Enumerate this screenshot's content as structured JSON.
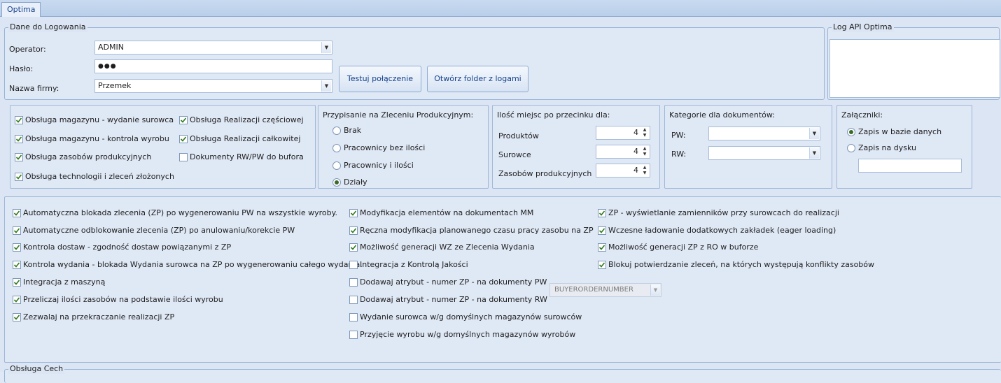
{
  "tabs": [
    {
      "label": "Optima"
    }
  ],
  "login": {
    "title": "Dane do Logowania",
    "operator_label": "Operator:",
    "operator_value": "ADMIN",
    "password_label": "Hasło:",
    "password_value": "●●●",
    "company_label": "Nazwa firmy:",
    "company_value": "Przemek",
    "test_button": "Testuj połączenie",
    "open_logs_button": "Otwórz folder z logami"
  },
  "log": {
    "title": "Log API Optima"
  },
  "options": [
    {
      "label": "Obsługa magazynu - wydanie surowca",
      "checked": true
    },
    {
      "label": "Obsługa magazynu - kontrola wyrobu",
      "checked": true
    },
    {
      "label": "Obsługa zasobów produkcyjnych",
      "checked": true
    },
    {
      "label": "Obsługa technologii i zleceń złożonych",
      "checked": true
    },
    {
      "label": "Obsługa Realizacji częściowej",
      "checked": true
    },
    {
      "label": "Obsługa Realizacji całkowitej",
      "checked": true
    },
    {
      "label": "Dokumenty RW/PW do bufora",
      "checked": false
    }
  ],
  "assignment": {
    "title": "Przypisanie na Zleceniu Produkcyjnym:",
    "options": [
      "Brak",
      "Pracownicy bez ilości",
      "Pracownicy i ilości",
      "Działy"
    ],
    "selected": "Działy"
  },
  "decimals": {
    "title": "Ilość miejsc po przecinku dla:",
    "rows": [
      {
        "label": "Produktów",
        "value": "4"
      },
      {
        "label": "Surowce",
        "value": "4"
      },
      {
        "label": "Zasobów produkcyjnych",
        "value": "4"
      }
    ]
  },
  "categories": {
    "title": "Kategorie dla dokumentów:",
    "pw_label": "PW:",
    "pw_value": "",
    "rw_label": "RW:",
    "rw_value": ""
  },
  "attachments": {
    "title": "Załączniki:",
    "options": [
      "Zapis w bazie danych",
      "Zapis na dysku"
    ],
    "selected": "Zapis w bazie danych",
    "path_value": ""
  },
  "settings_col1": [
    {
      "label": "Automatyczna blokada zlecenia (ZP) po wygenerowaniu PW na wszystkie wyroby.",
      "checked": true
    },
    {
      "label": "Automatyczne odblokowanie zlecenia (ZP) po anulowaniu/korekcie PW",
      "checked": true
    },
    {
      "label": "Kontrola dostaw - zgodność dostaw powiązanymi z ZP",
      "checked": true
    },
    {
      "label": "Kontrola wydania - blokada Wydania surowca na ZP po wygenerowaniu całego wydania.",
      "checked": true
    },
    {
      "label": "Integracja z maszyną",
      "checked": true
    },
    {
      "label": "Przeliczaj ilości zasobów na podstawie ilości wyrobu",
      "checked": true
    },
    {
      "label": "Zezwalaj na przekraczanie realizacji ZP",
      "checked": true
    }
  ],
  "settings_col2": [
    {
      "label": "Modyfikacja elementów na dokumentach MM",
      "checked": true
    },
    {
      "label": "Ręczna modyfikacja planowanego czasu pracy zasobu  na ZP",
      "checked": true
    },
    {
      "label": "Możliwość generacji WZ ze Zlecenia Wydania",
      "checked": true
    },
    {
      "label": "Integracja z Kontrolą Jakości",
      "checked": false
    },
    {
      "label": "Dodawaj atrybut - numer ZP - na dokumenty PW",
      "checked": false
    },
    {
      "label": "Dodawaj atrybut - numer ZP - na dokumenty RW",
      "checked": false
    },
    {
      "label": "Wydanie surowca w/g domyślnych magazynów surowców",
      "checked": false
    },
    {
      "label": "Przyjęcie wyrobu w/g domyślnych magazynów wyrobów",
      "checked": false
    }
  ],
  "attribute_combo": {
    "value": "BUYERORDERNUMBER"
  },
  "settings_col3": [
    {
      "label": "ZP - wyświetlanie zamienników przy surowcach do realizacji",
      "checked": true
    },
    {
      "label": "Wczesne ładowanie dodatkowych zakładek (eager loading)",
      "checked": true
    },
    {
      "label": "Możliwość generacji ZP z RO w buforze",
      "checked": true
    },
    {
      "label": "Blokuj potwierdzanie zleceń, na których występują konflikty zasobów",
      "checked": true
    }
  ],
  "features": {
    "title": "Obsługa Cech"
  }
}
